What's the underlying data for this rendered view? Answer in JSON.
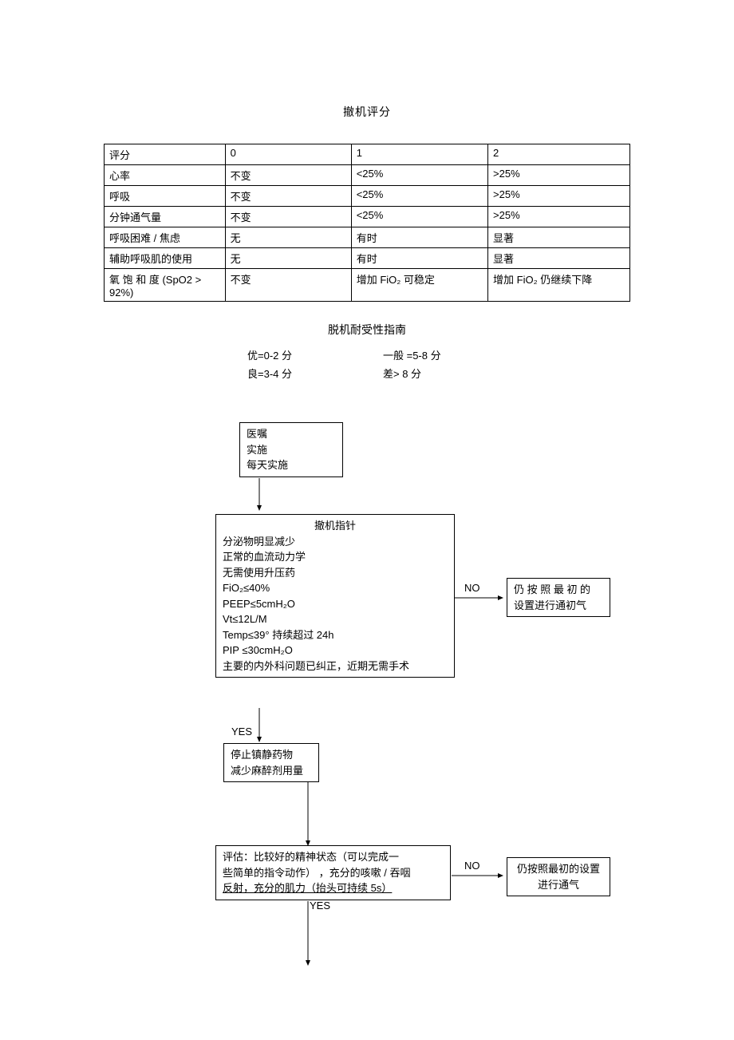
{
  "title": "撤机评分",
  "table": {
    "header": [
      "评分",
      "0",
      "1",
      "2"
    ],
    "rows": [
      [
        "心率",
        "不变",
        "<25%",
        ">25%"
      ],
      [
        "呼吸",
        "不变",
        "<25%",
        ">25%"
      ],
      [
        "分钟通气量",
        "不变",
        "<25%",
        ">25%"
      ],
      [
        "呼吸困难 / 焦虑",
        "无",
        "有时",
        "显著"
      ],
      [
        "辅助呼吸肌的使用",
        "无",
        "有时",
        "显著"
      ],
      [
        "氧 饱 和 度 (SpO2 > 92%)",
        "不变",
        "增加 FiO₂ 可稳定",
        "增加 FiO₂ 仍继续下降"
      ]
    ]
  },
  "guide": {
    "title": "脱机耐受性指南",
    "items": [
      [
        "优=0-2 分",
        "一般 =5-8 分"
      ],
      [
        "良=3-4 分",
        "差> 8 分"
      ]
    ]
  },
  "flow": {
    "box1": {
      "l1": "医嘱",
      "l2": "实施",
      "l3": "每天实施"
    },
    "box2": {
      "title": "撤机指针",
      "l1": "分泌物明显减少",
      "l2": "正常的血流动力学",
      "l3": "无需使用升压药",
      "l4": "FiO₂≤40%",
      "l5": "PEEP≤5cmH₂O",
      "l6": "Vt≤12L/M",
      "l7": "Temp≤39° 持续超过  24h",
      "l8": "PIP ≤30cmH₂O",
      "l9": "主要的内外科问题已纠正，近期无需手术"
    },
    "box3": {
      "l1": "仍 按 照 最 初 的",
      "l2": "设置进行通初气"
    },
    "box4": {
      "l1": "停止镇静药物",
      "l2": "减少麻醉剂用量"
    },
    "box5": {
      "l1": "评估：比较好的精神状态（可以完成一",
      "l2": "些简单的指令动作） ，充分的咳嗽 / 吞咽",
      "l3": "反射，充分的肌力（抬头可持续    5s）"
    },
    "box6": {
      "l1": "仍按照最初的设置",
      "l2": "进行通气"
    },
    "labels": {
      "yes": "YES",
      "no": "NO"
    }
  }
}
